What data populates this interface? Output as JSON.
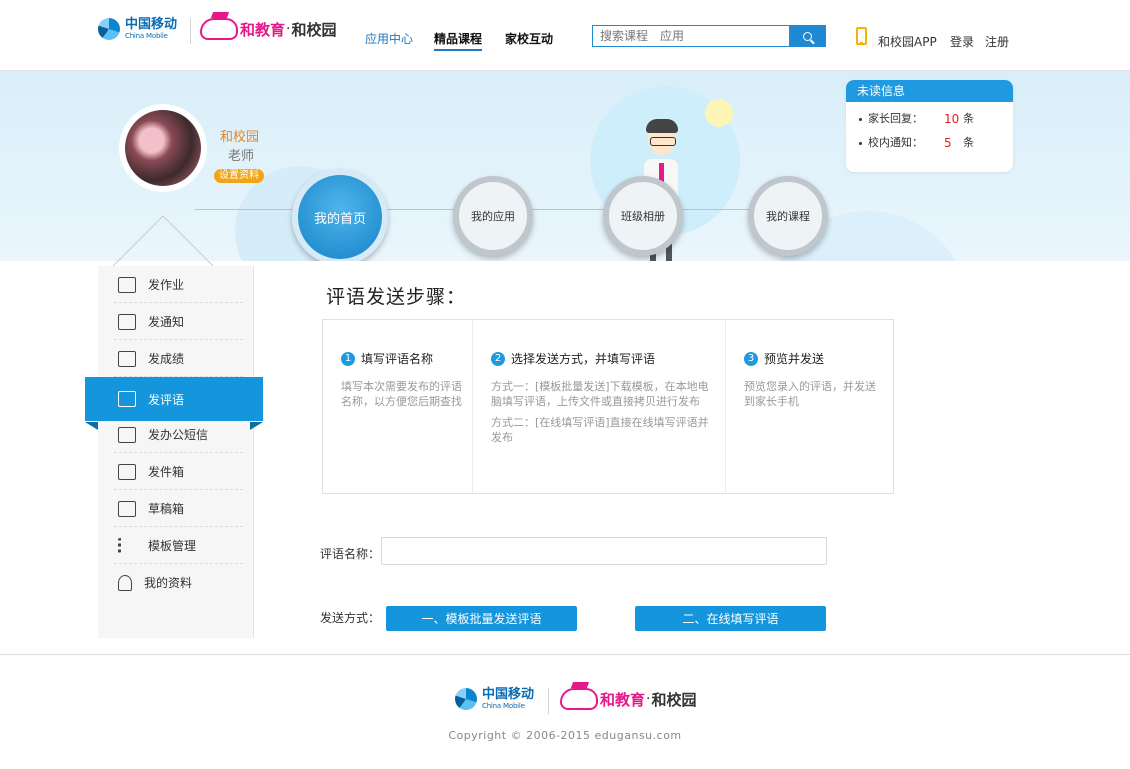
{
  "header": {
    "cm_logo_zh": "中国移动",
    "cm_logo_en": "China Mobile",
    "he_brand": "和教育",
    "he_dot": "·",
    "he_sub": "和校园",
    "nav": [
      "应用中心",
      "精品课程",
      "家校互动"
    ],
    "search_placeholder": "搜索课程　应用",
    "app_link": "和校园APP",
    "login": "登录",
    "register": "注册"
  },
  "profile": {
    "name": "和校园",
    "role": "老师",
    "settings": "设置资料"
  },
  "banner_nav": [
    "我的首页",
    "我的应用",
    "班级相册",
    "我的课程"
  ],
  "unread": {
    "title": "未读信息",
    "items": [
      {
        "label": "家长回复：",
        "count": "10",
        "unit": "条"
      },
      {
        "label": "校内通知：",
        "count": "5",
        "unit": "条"
      }
    ]
  },
  "sidebar": {
    "items": [
      "发作业",
      "发通知",
      "发成绩",
      "发评语",
      "发办公短信",
      "发件箱",
      "草稿箱",
      "模板管理",
      "我的资料"
    ],
    "active_index": 3
  },
  "main": {
    "title": "评语发送步骤：",
    "steps": [
      {
        "num": "1",
        "title": "填写评语名称",
        "desc": [
          "填写本次需要发布的评语名称，以方便您后期查找"
        ]
      },
      {
        "num": "2",
        "title": "选择发送方式，并填写评语",
        "desc": [
          "方式一：[模板批量发送]下载模板，在本地电脑填写评语，上传文件或直接拷贝进行发布",
          "方式二：[在线填写评语]直接在线填写评语并发布"
        ]
      },
      {
        "num": "3",
        "title": "预览并发送",
        "desc": [
          "预览您录入的评语，并发送到家长手机"
        ]
      }
    ],
    "name_label": "评语名称：",
    "name_value": "",
    "send_label": "发送方式：",
    "send_btn1": "一、模板批量发送评语",
    "send_btn2": "二、在线填写评语"
  },
  "footer": {
    "copyright": "Copyright © 2006-2015  edugansu.com"
  },
  "colors": {
    "primary": "#1596dc",
    "brand_pink": "#e5198a",
    "accent_orange": "#f2a417",
    "alert_red": "#e02020"
  }
}
